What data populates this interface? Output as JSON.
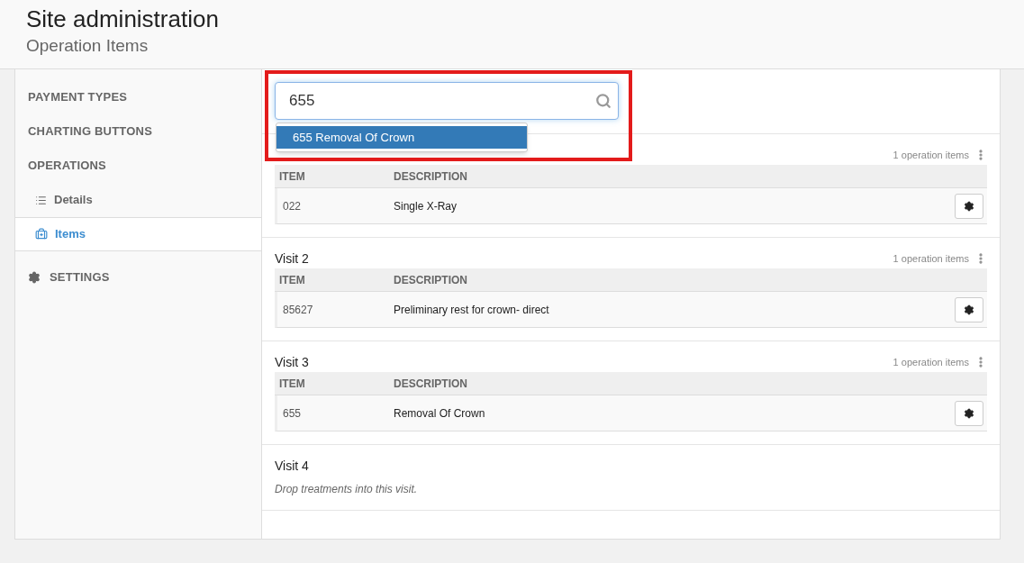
{
  "header": {
    "title": "Site administration",
    "subtitle": "Operation Items"
  },
  "sidebar": {
    "items": [
      {
        "label": "PAYMENT TYPES",
        "kind": "section",
        "selected": false
      },
      {
        "label": "CHARTING BUTTONS",
        "kind": "section",
        "selected": false
      },
      {
        "label": "OPERATIONS",
        "kind": "section",
        "selected": false
      },
      {
        "label": "Details",
        "kind": "sub-list",
        "selected": false
      },
      {
        "label": "Items",
        "kind": "sub-kit",
        "selected": true
      },
      {
        "label": "SETTINGS",
        "kind": "section-gear",
        "selected": false
      }
    ]
  },
  "search": {
    "value": "655",
    "suggestions": [
      {
        "label": "655 Removal Of Crown",
        "selected": true
      }
    ]
  },
  "visits": [
    {
      "count": "1 operation items",
      "columns": [
        "ITEM",
        "DESCRIPTION"
      ],
      "rows": [
        [
          "022",
          "Single X-Ray"
        ]
      ]
    },
    {
      "title": "Visit 2",
      "count": "1 operation items",
      "columns": [
        "ITEM",
        "DESCRIPTION"
      ],
      "rows": [
        [
          "85627",
          "Preliminary rest for crown- direct"
        ]
      ]
    },
    {
      "title": "Visit 3",
      "count": "1 operation items",
      "columns": [
        "ITEM",
        "DESCRIPTION"
      ],
      "rows": [
        [
          "655",
          "Removal Of Crown"
        ]
      ]
    },
    {
      "title": "Visit 4",
      "empty_text": "Drop treatments into this visit."
    }
  ]
}
